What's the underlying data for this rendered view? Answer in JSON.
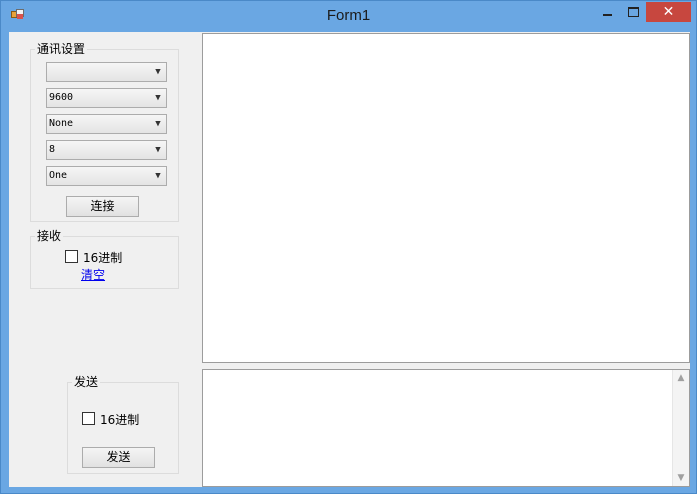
{
  "window": {
    "title": "Form1"
  },
  "comm_settings": {
    "legend": "通讯设置",
    "port": "",
    "baud_rate": "9600",
    "parity": "None",
    "data_bits": "8",
    "stop_bits": "One",
    "connect_label": "连接"
  },
  "receive": {
    "legend": "接收",
    "hex_label": "16进制",
    "clear_label": "清空"
  },
  "send": {
    "legend": "发送",
    "hex_label": "16进制",
    "send_label": "发送"
  },
  "icons": {
    "dropdown": "chevron-down-icon",
    "scroll_up": "scroll-up-icon",
    "scroll_down": "scroll-down-icon",
    "close": "close-icon"
  }
}
